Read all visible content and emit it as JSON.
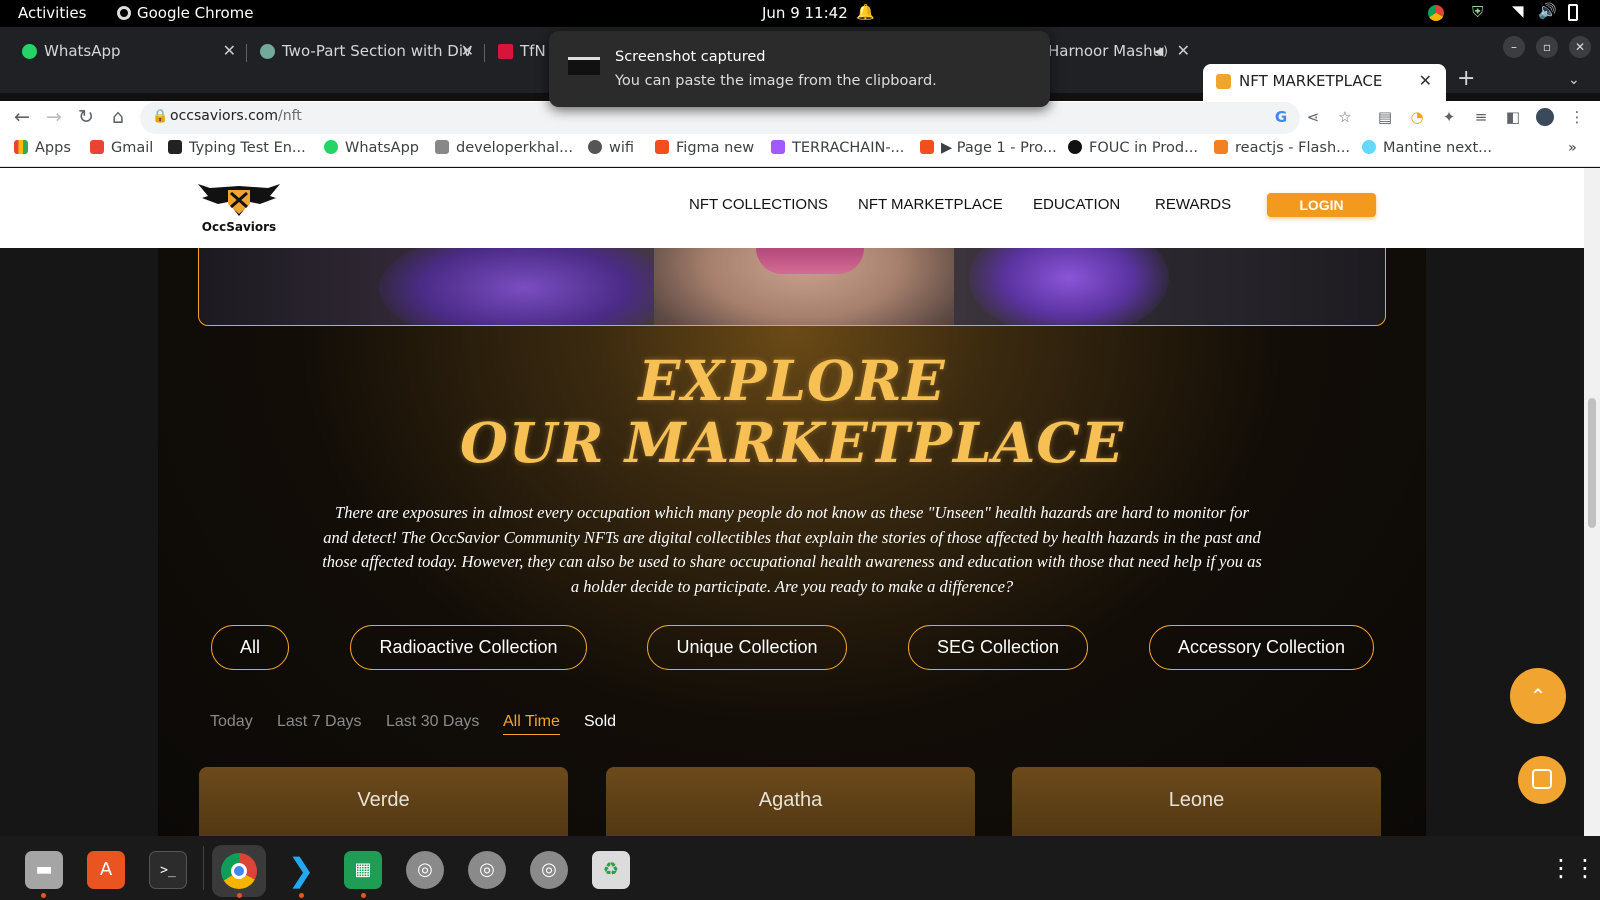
{
  "system": {
    "activities": "Activities",
    "app_name": "Google Chrome",
    "clock": "Jun 9  11:42"
  },
  "toast": {
    "title": "Screenshot captured",
    "message": "You can paste the image from the clipboard."
  },
  "tabs": [
    {
      "title": "WhatsApp",
      "fav_color": "#25d366"
    },
    {
      "title": "Two-Part Section with Div",
      "fav_color": "#74aa9c"
    },
    {
      "title": "TfN",
      "fav_color": "#d7153a"
    },
    {
      "title": "Harnoor Mashu",
      "fav_color": "#cccccc"
    },
    {
      "title": "NFT MARKETPLACE",
      "fav_color": "#f2a431"
    }
  ],
  "address_bar": {
    "domain": "occsaviors.com",
    "path": "/nft"
  },
  "bookmarks": [
    {
      "label": "Apps"
    },
    {
      "label": "Gmail"
    },
    {
      "label": "Typing Test En..."
    },
    {
      "label": "WhatsApp"
    },
    {
      "label": "developerkhal..."
    },
    {
      "label": "wifi"
    },
    {
      "label": "Figma new"
    },
    {
      "label": "TERRACHAIN-..."
    },
    {
      "label": "▶ Page 1 - Pro..."
    },
    {
      "label": "FOUC in Prod..."
    },
    {
      "label": "reactjs - Flash..."
    },
    {
      "label": "Mantine next..."
    },
    {
      "label": "»"
    }
  ],
  "site": {
    "logo_text": "OccSaviors",
    "nav": [
      "NFT COLLECTIONS",
      "NFT MARKETPLACE",
      "EDUCATION",
      "REWARDS"
    ],
    "login": "LOGIN",
    "heading_line1": "EXPLORE",
    "heading_line2": "OUR MARKETPLACE",
    "description": "There are exposures in almost every occupation which many people do not know as these \"Unseen\" health hazards are hard to monitor for and detect! The OccSavior Community NFTs are digital collectibles that explain the stories of those affected by health hazards in the past and those affected today. However, they can also be used to share occupational health awareness and education with those that need help if you as a holder decide to participate. Are you ready to make a difference?",
    "collections": [
      "All",
      "Radioactive Collection",
      "Unique Collection",
      "SEG Collection",
      "Accessory Collection"
    ],
    "time_filters": [
      "Today",
      "Last 7 Days",
      "Last 30 Days",
      "All Time",
      "Sold"
    ],
    "active_filter": "All Time",
    "cards": [
      {
        "name": "Verde"
      },
      {
        "name": "Agatha"
      },
      {
        "name": "Leone"
      }
    ],
    "accent_color": "#f2a431"
  },
  "dock": {
    "apps": [
      "files",
      "software",
      "terminal",
      "chrome",
      "vscode",
      "spreadsheet",
      "disc",
      "disc",
      "disc",
      "trash"
    ]
  }
}
